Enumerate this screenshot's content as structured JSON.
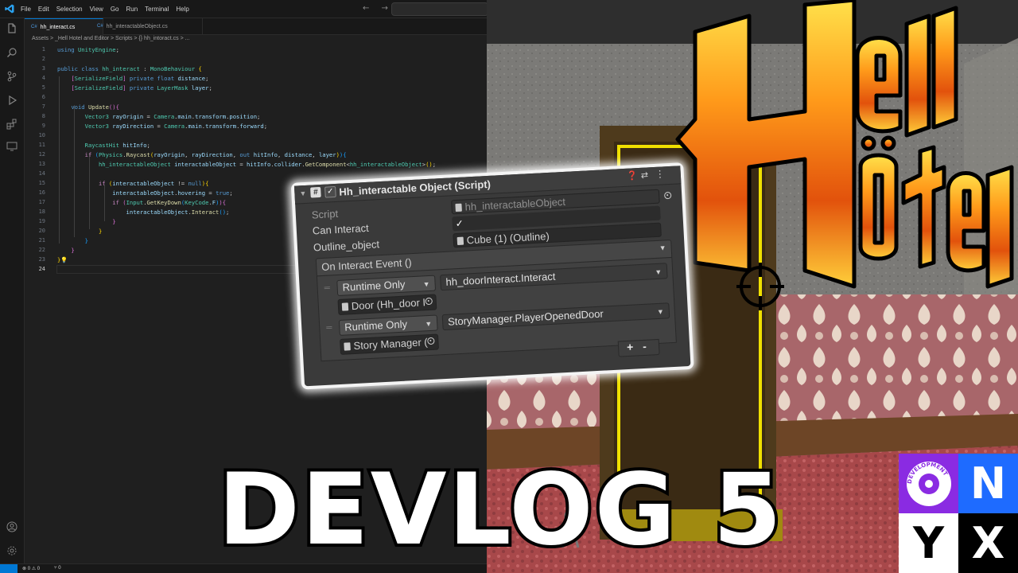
{
  "vscode": {
    "menu": [
      "File",
      "Edit",
      "Selection",
      "View",
      "Go",
      "Run",
      "Terminal",
      "Help"
    ],
    "nav_arrows": "← →",
    "tabs": [
      {
        "label": "hh_interact.cs",
        "active": true
      },
      {
        "label": "hh_interactableObject.cs",
        "active": false
      }
    ],
    "breadcrumb": "Assets > _Hell Hotel and Editor > Scripts > {} hh_intoract.cs > ...",
    "line_numbers": [
      "1",
      "2",
      "3",
      "4",
      "5",
      "6",
      "7",
      "8",
      "9",
      "10",
      "11",
      "12",
      "13",
      "14",
      "15",
      "16",
      "17",
      "18",
      "19",
      "20",
      "21",
      "22",
      "23",
      "24"
    ],
    "status": {
      "errors": "⊗ 0 ⚠ 0",
      "ports": "⑂ 0"
    }
  },
  "inspector": {
    "title": "Hh_interactable Object (Script)",
    "rows": {
      "script_label": "Script",
      "script_value": "hh_interactableObject",
      "can_interact_label": "Can Interact",
      "outline_label": "Outline_object",
      "outline_value": "Cube (1) (Outline)"
    },
    "event_label": "On Interact Event ()",
    "events": [
      {
        "mode": "Runtime Only",
        "function": "hh_doorInteract.Interact",
        "target": "Door (Hh_door I"
      },
      {
        "mode": "Runtime Only",
        "function": "StoryManager.PlayerOpenedDoor",
        "target": "Story Manager ("
      }
    ],
    "add": "+",
    "remove": "-"
  },
  "game_title": {
    "line1": "Hell",
    "line2": "Hötel"
  },
  "devlog_title": "DEVLOG 5",
  "logo": {
    "ring_text": "DEVELOPMENT",
    "letters": [
      "N",
      "Y",
      "X"
    ]
  },
  "colors": {
    "vscode_bg": "#1f1f1f",
    "accent": "#0078d4",
    "logo_purple": "#8a2be2",
    "logo_blue": "#1e6bff",
    "door_outline": "#f0e000"
  }
}
